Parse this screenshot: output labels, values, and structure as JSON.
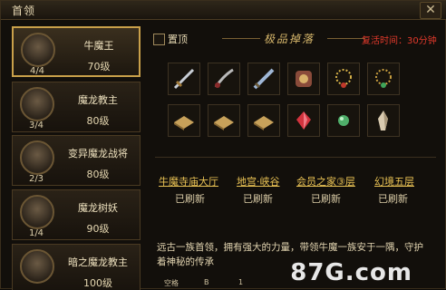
{
  "window": {
    "title": "首领",
    "close_label": "✕"
  },
  "bosses": [
    {
      "name": "牛魔王",
      "level": "70级",
      "count": "4/4",
      "selected": true
    },
    {
      "name": "魔龙教主",
      "level": "80级",
      "count": "3/4",
      "selected": false
    },
    {
      "name": "变异魔龙战将",
      "level": "80级",
      "count": "2/3",
      "selected": false
    },
    {
      "name": "魔龙树妖",
      "level": "90级",
      "count": "1/4",
      "selected": false
    },
    {
      "name": "暗之魔龙教主",
      "level": "100级",
      "count": "",
      "selected": false
    }
  ],
  "header": {
    "pin_label": "置顶",
    "drops_title": "极品掉落",
    "revive_label": "复活时间：30分钟"
  },
  "drops": [
    {
      "icon": "sword-icon"
    },
    {
      "icon": "dagger-icon"
    },
    {
      "icon": "blade-icon"
    },
    {
      "icon": "armor-icon"
    },
    {
      "icon": "necklace-icon"
    },
    {
      "icon": "jade-necklace-icon"
    },
    {
      "icon": "book-icon"
    },
    {
      "icon": "book-icon"
    },
    {
      "icon": "book-icon"
    },
    {
      "icon": "red-gem-icon"
    },
    {
      "icon": "green-orb-icon"
    },
    {
      "icon": "crystal-icon"
    }
  ],
  "maps": [
    {
      "name": "牛魔寺庙大厅",
      "status": "已刷新"
    },
    {
      "name": "地宫·峡谷",
      "status": "已刷新"
    },
    {
      "name": "会员之家③层",
      "status": "已刷新"
    },
    {
      "name": "幻境五层",
      "status": "已刷新"
    }
  ],
  "description": "远古一族首领，拥有强大的力量，带领牛魔一族安于一隅，守护着神秘的传承",
  "bottom": {
    "left": "空格",
    "mid": "B",
    "right": "1"
  },
  "watermark": "87G.com",
  "colors": {
    "accent": "#c9a04a",
    "revive": "#e2392b",
    "link": "#e9c254"
  }
}
